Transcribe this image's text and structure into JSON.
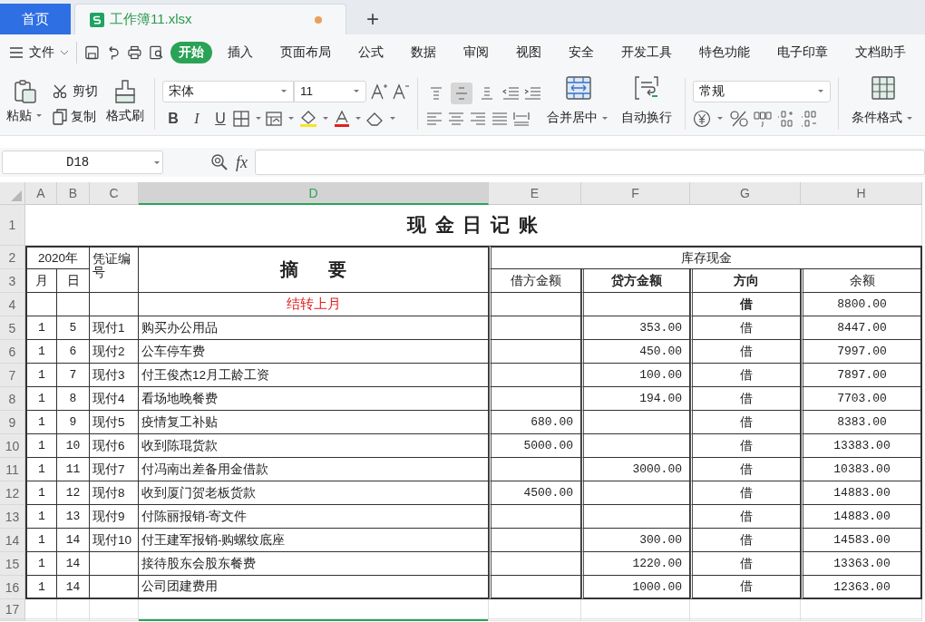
{
  "tabs": [
    {
      "label": "首页",
      "kind": "home",
      "selected": false
    },
    {
      "label": "工作簿11.xlsx",
      "kind": "file",
      "selected": true,
      "unsaved": true
    }
  ],
  "new_tab": "+",
  "menu": {
    "file": "文件",
    "items": [
      {
        "label": "开始",
        "selected": true
      },
      {
        "label": "插入",
        "selected": false
      },
      {
        "label": "页面布局",
        "selected": false
      },
      {
        "label": "公式",
        "selected": false
      },
      {
        "label": "数据",
        "selected": false
      },
      {
        "label": "审阅",
        "selected": false
      },
      {
        "label": "视图",
        "selected": false
      },
      {
        "label": "安全",
        "selected": false
      },
      {
        "label": "开发工具",
        "selected": false
      },
      {
        "label": "特色功能",
        "selected": false
      },
      {
        "label": "电子印章",
        "selected": false
      },
      {
        "label": "文档助手",
        "selected": false
      }
    ]
  },
  "ribbon": {
    "paste": "粘贴",
    "cut": "剪切",
    "copy": "复制",
    "format_painter": "格式刷",
    "font": "宋体",
    "font_size": "11",
    "format_buttons": [
      "B",
      "I",
      "U"
    ],
    "vertical_align": [
      {
        "selected": false
      },
      {
        "selected": true
      },
      {
        "selected": false
      }
    ],
    "merge": "合并居中",
    "wrap": "自动换行",
    "number_format": "常规",
    "conditional_format": "条件格式"
  },
  "formula_bar": {
    "cell_ref": "D18",
    "fx": "fx"
  },
  "sheet": {
    "columns": [
      {
        "label": "A",
        "selected": false
      },
      {
        "label": "B",
        "selected": false
      },
      {
        "label": "C",
        "selected": false
      },
      {
        "label": "D",
        "selected": true
      },
      {
        "label": "E",
        "selected": false
      },
      {
        "label": "F",
        "selected": false
      },
      {
        "label": "G",
        "selected": false
      },
      {
        "label": "H",
        "selected": false
      }
    ],
    "row_headers": [
      "1",
      "2",
      "3",
      "4",
      "5",
      "6",
      "7",
      "8",
      "9",
      "10",
      "11",
      "12",
      "13",
      "14",
      "15",
      "16",
      "17"
    ],
    "title": "现 金 日 记 账",
    "header": {
      "year": "2020年",
      "month": "月",
      "day": "日",
      "voucher": "凭证编号",
      "summary": "摘      要",
      "cash": "库存现金",
      "debit": "借方金额",
      "credit": "贷方金额",
      "direction": "方向",
      "balance": "余额"
    },
    "rows": [
      {
        "kind": "carryover",
        "month": "",
        "day": "",
        "voucher": "",
        "summary": "结转上月",
        "debit": "",
        "credit": "",
        "direction": "借",
        "balance": "8800.00"
      },
      {
        "kind": "entry",
        "month": "1",
        "day": "5",
        "voucher": "现付1",
        "summary": "购买办公用品",
        "debit": "",
        "credit": "353.00",
        "direction": "借",
        "balance": "8447.00"
      },
      {
        "kind": "entry",
        "month": "1",
        "day": "6",
        "voucher": "现付2",
        "summary": "公车停车费",
        "debit": "",
        "credit": "450.00",
        "direction": "借",
        "balance": "7997.00"
      },
      {
        "kind": "entry",
        "month": "1",
        "day": "7",
        "voucher": "现付3",
        "summary": "付王俊杰12月工龄工资",
        "debit": "",
        "credit": "100.00",
        "direction": "借",
        "balance": "7897.00"
      },
      {
        "kind": "entry",
        "month": "1",
        "day": "8",
        "voucher": "现付4",
        "summary": "看场地晚餐费",
        "debit": "",
        "credit": "194.00",
        "direction": "借",
        "balance": "7703.00"
      },
      {
        "kind": "entry",
        "month": "1",
        "day": "9",
        "voucher": "现付5",
        "summary": "疫情复工补贴",
        "debit": "680.00",
        "credit": "",
        "direction": "借",
        "balance": "8383.00"
      },
      {
        "kind": "entry",
        "month": "1",
        "day": "10",
        "voucher": "现付6",
        "summary": "收到陈琨货款",
        "debit": "5000.00",
        "credit": "",
        "direction": "借",
        "balance": "13383.00"
      },
      {
        "kind": "entry",
        "month": "1",
        "day": "11",
        "voucher": "现付7",
        "summary": "付冯南出差备用金借款",
        "debit": "",
        "credit": "3000.00",
        "direction": "借",
        "balance": "10383.00"
      },
      {
        "kind": "entry",
        "month": "1",
        "day": "12",
        "voucher": "现付8",
        "summary": "收到厦门贺老板货款",
        "debit": "4500.00",
        "credit": "",
        "direction": "借",
        "balance": "14883.00"
      },
      {
        "kind": "entry",
        "month": "1",
        "day": "13",
        "voucher": "现付9",
        "summary": "付陈丽报销-寄文件",
        "debit": "",
        "credit": "",
        "direction": "借",
        "balance": "14883.00"
      },
      {
        "kind": "entry",
        "month": "1",
        "day": "14",
        "voucher": "现付10",
        "summary": "付王建军报销-购螺纹底座",
        "debit": "",
        "credit": "300.00",
        "direction": "借",
        "balance": "14583.00"
      },
      {
        "kind": "entry",
        "month": "1",
        "day": "14",
        "voucher": "",
        "summary": "接待股东会股东餐费",
        "debit": "",
        "credit": "1220.00",
        "direction": "借",
        "balance": "13363.00"
      },
      {
        "kind": "entry",
        "month": "1",
        "day": "14",
        "voucher": "",
        "summary": "公司团建费用",
        "debit": "",
        "credit": "1000.00",
        "direction": "借",
        "balance": "12363.00"
      }
    ]
  }
}
